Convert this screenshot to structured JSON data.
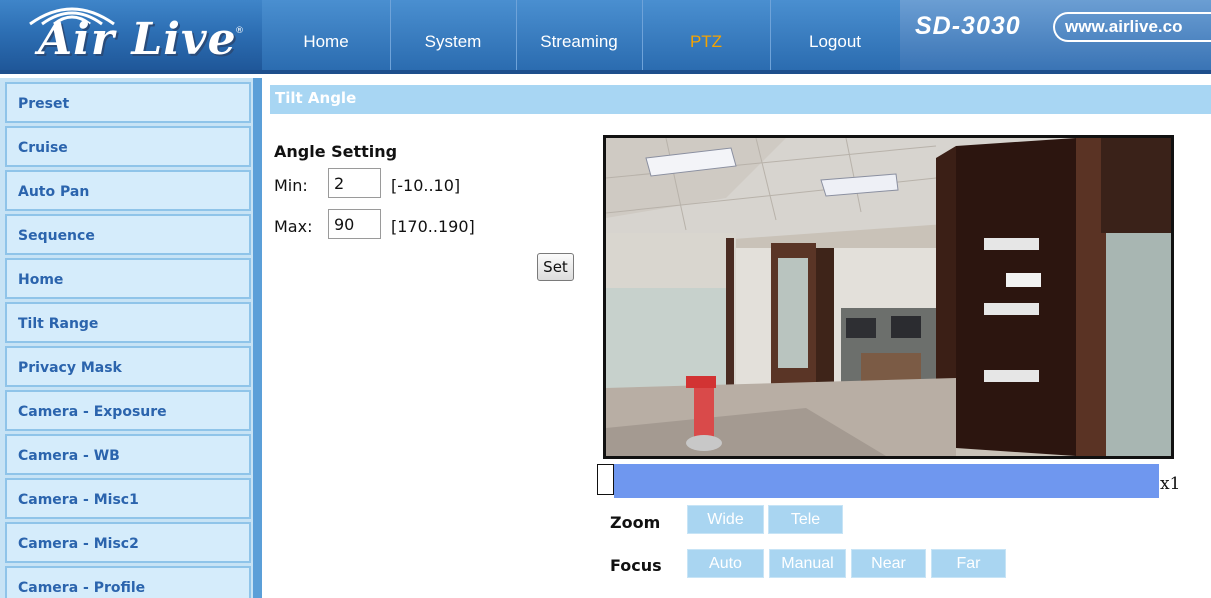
{
  "header": {
    "brand": "Air Live",
    "model": "SD-3030",
    "website": "www.airlive.co",
    "nav": [
      {
        "label": "Home",
        "active": false
      },
      {
        "label": "System",
        "active": false
      },
      {
        "label": "Streaming",
        "active": false
      },
      {
        "label": "PTZ",
        "active": true
      },
      {
        "label": "Logout",
        "active": false
      }
    ]
  },
  "sidebar": {
    "items": [
      {
        "label": "Preset"
      },
      {
        "label": "Cruise"
      },
      {
        "label": "Auto Pan"
      },
      {
        "label": "Sequence"
      },
      {
        "label": "Home"
      },
      {
        "label": "Tilt Range"
      },
      {
        "label": "Privacy Mask"
      },
      {
        "label": "Camera - Exposure"
      },
      {
        "label": "Camera - WB"
      },
      {
        "label": "Camera - Misc1"
      },
      {
        "label": "Camera - Misc2"
      },
      {
        "label": "Camera - Profile"
      }
    ]
  },
  "main": {
    "section_title": "Tilt Angle",
    "angle_heading": "Angle Setting",
    "min": {
      "label": "Min:",
      "value": "2",
      "range": "[-10..10]"
    },
    "max": {
      "label": "Max:",
      "value": "90",
      "range": "[170..190]"
    },
    "set_label": "Set"
  },
  "controls": {
    "zoom_level": "x1",
    "zoom_label": "Zoom",
    "zoom_buttons": [
      "Wide",
      "Tele"
    ],
    "focus_label": "Focus",
    "focus_buttons": [
      "Auto",
      "Manual",
      "Near",
      "Far"
    ]
  },
  "colors": {
    "header_blue": "#2d6fb4",
    "active_nav": "#f5a300",
    "sidebar_text": "#2b64ad",
    "zoom_track": "#6f97ef",
    "ctl_button": "#a9d5f1"
  }
}
